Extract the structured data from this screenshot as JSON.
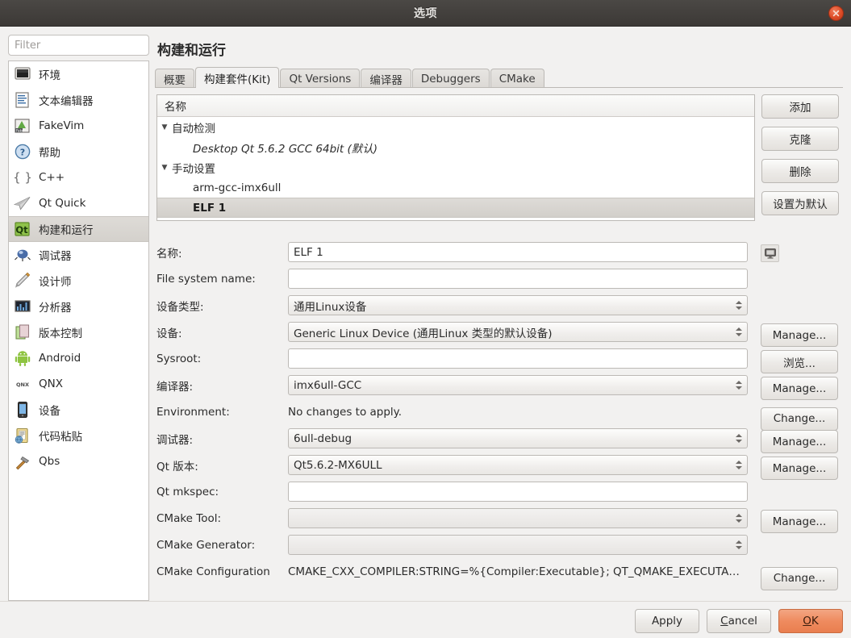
{
  "window": {
    "title": "选项",
    "close_icon": "close-icon"
  },
  "sidebar": {
    "filter_placeholder": "Filter",
    "filter_value": "",
    "items": [
      {
        "label": "环境",
        "icon": "monitor-icon",
        "selected": false
      },
      {
        "label": "文本编辑器",
        "icon": "text-editor-icon",
        "selected": false
      },
      {
        "label": "FakeVim",
        "icon": "fakevim-icon",
        "selected": false
      },
      {
        "label": "帮助",
        "icon": "help-icon",
        "selected": false
      },
      {
        "label": "C++",
        "icon": "braces-icon",
        "selected": false
      },
      {
        "label": "Qt Quick",
        "icon": "paperplane-icon",
        "selected": false
      },
      {
        "label": "构建和运行",
        "icon": "qt-build-run-icon",
        "selected": true
      },
      {
        "label": "调试器",
        "icon": "debugger-bug-icon",
        "selected": false
      },
      {
        "label": "设计师",
        "icon": "designer-pen-icon",
        "selected": false
      },
      {
        "label": "分析器",
        "icon": "analyzer-icon",
        "selected": false
      },
      {
        "label": "版本控制",
        "icon": "version-control-icon",
        "selected": false
      },
      {
        "label": "Android",
        "icon": "android-icon",
        "selected": false
      },
      {
        "label": "QNX",
        "icon": "qnx-icon",
        "selected": false
      },
      {
        "label": "设备",
        "icon": "device-phone-icon",
        "selected": false
      },
      {
        "label": "代码粘贴",
        "icon": "code-paste-icon",
        "selected": false
      },
      {
        "label": "Qbs",
        "icon": "qbs-hammer-icon",
        "selected": false
      }
    ]
  },
  "page": {
    "heading": "构建和运行",
    "tabs": [
      {
        "label": "概要",
        "active": false
      },
      {
        "label": "构建套件(Kit)",
        "active": true
      },
      {
        "label": "Qt Versions",
        "active": false
      },
      {
        "label": "编译器",
        "active": false
      },
      {
        "label": "Debuggers",
        "active": false
      },
      {
        "label": "CMake",
        "active": false
      }
    ]
  },
  "kit_tree": {
    "header": "名称",
    "rows": [
      {
        "label": "自动检测",
        "type": "group",
        "arrow": "▼",
        "italic": false,
        "selected": false
      },
      {
        "label": "Desktop Qt 5.6.2 GCC 64bit (默认)",
        "type": "child",
        "arrow": "",
        "italic": true,
        "selected": false
      },
      {
        "label": "手动设置",
        "type": "group",
        "arrow": "▼",
        "italic": false,
        "selected": false
      },
      {
        "label": "arm-gcc-imx6ull",
        "type": "child",
        "arrow": "",
        "italic": false,
        "selected": false
      },
      {
        "label": "ELF 1",
        "type": "child",
        "arrow": "",
        "italic": false,
        "selected": true
      }
    ],
    "buttons": [
      {
        "label": "添加",
        "name": "add-kit-button"
      },
      {
        "label": "克隆",
        "name": "clone-kit-button"
      },
      {
        "label": "删除",
        "name": "remove-kit-button"
      },
      {
        "label": "设置为默认",
        "name": "make-default-kit-button"
      }
    ]
  },
  "form": {
    "name": {
      "label": "名称:",
      "value": "ELF 1",
      "icon_button": "monitor-icon"
    },
    "file_system_name": {
      "label": "File system name:",
      "value": "",
      "placeholder": ""
    },
    "device_type": {
      "label": "设备类型:",
      "value": "通用Linux设备"
    },
    "device": {
      "label": "设备:",
      "value": "Generic Linux Device (通用Linux 类型的默认设备)",
      "button": "Manage..."
    },
    "sysroot": {
      "label": "Sysroot:",
      "value": "",
      "button": "浏览..."
    },
    "compiler": {
      "label": "编译器:",
      "value": "imx6ull-GCC",
      "button": "Manage..."
    },
    "environment": {
      "label": "Environment:",
      "value": "No changes to apply.",
      "button": "Change..."
    },
    "debugger": {
      "label": "调试器:",
      "value": "6ull-debug",
      "button": "Manage..."
    },
    "qt_version": {
      "label": "Qt 版本:",
      "value": "Qt5.6.2-MX6ULL",
      "button": "Manage..."
    },
    "qt_mkspec": {
      "label": "Qt mkspec:",
      "value": ""
    },
    "cmake_tool": {
      "label": "CMake Tool:",
      "value": "",
      "button": "Manage...",
      "disabled": true
    },
    "cmake_generator": {
      "label": "CMake Generator:",
      "value": "",
      "disabled": true
    },
    "cmake_configuration": {
      "label": "CMake Configuration",
      "value": "CMAKE_CXX_COMPILER:STRING=%{Compiler:Executable}; QT_QMAKE_EXECUTA…",
      "button": "Change..."
    }
  },
  "footer": {
    "apply": "Apply",
    "cancel_pre": "",
    "cancel_acc": "C",
    "cancel_post": "ancel",
    "ok_acc": "O",
    "ok_post": "K"
  },
  "colors": {
    "accent_ok": "#ef8b5f",
    "titlebar": "#44413e",
    "window_bg": "#f2f1f0",
    "selection": "#d8d5d1"
  }
}
